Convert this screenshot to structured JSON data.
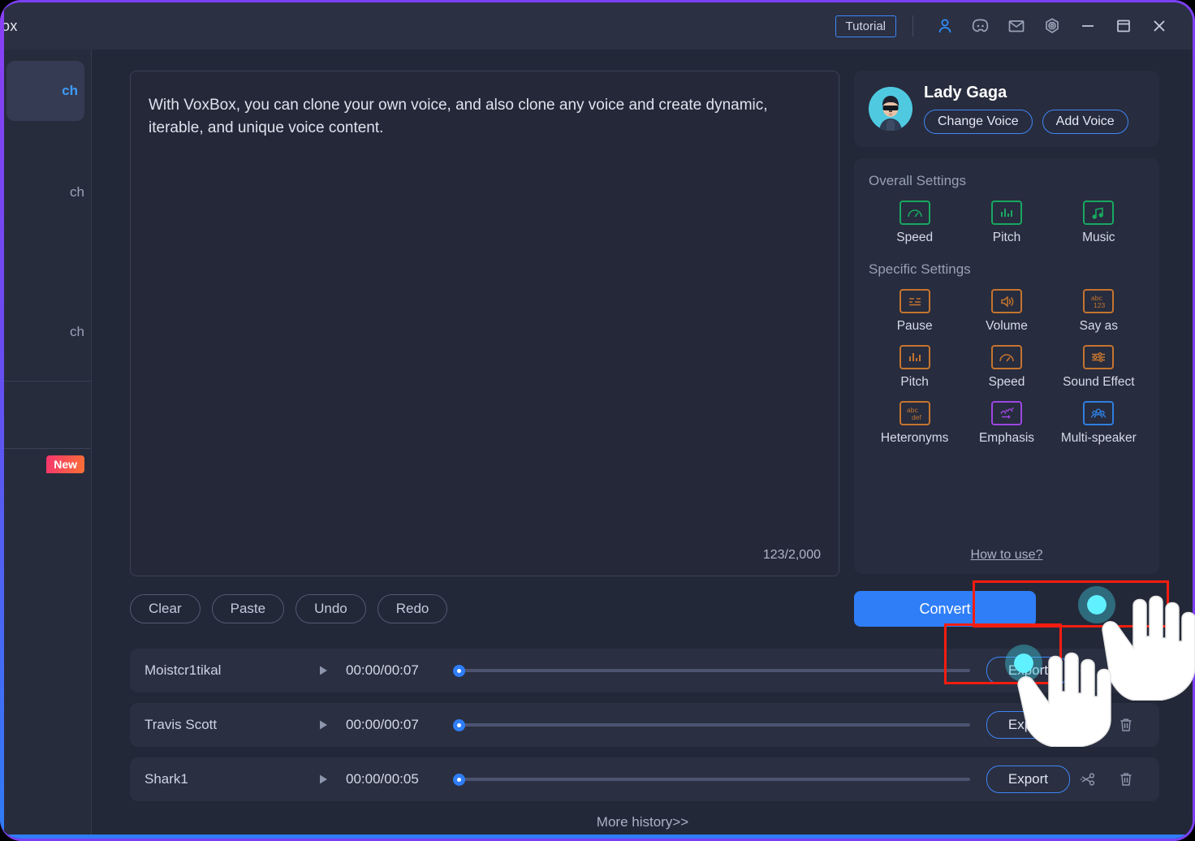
{
  "window": {
    "title": "ox",
    "accent_border": "#7b3ff2"
  },
  "titlebar": {
    "tutorial_label": "Tutorial",
    "icons": [
      {
        "name": "account-icon",
        "glyph": "person"
      },
      {
        "name": "discord-icon",
        "glyph": "gamepad"
      },
      {
        "name": "mail-icon",
        "glyph": "envelope"
      },
      {
        "name": "settings-icon",
        "glyph": "gear"
      },
      {
        "name": "minimize-icon",
        "glyph": "minus"
      },
      {
        "name": "maximize-icon",
        "glyph": "square"
      },
      {
        "name": "close-icon",
        "glyph": "cross"
      }
    ]
  },
  "sidebar": {
    "items": [
      {
        "label": "ch",
        "active": true
      },
      {
        "label": "ch",
        "active": false
      },
      {
        "label": "ch",
        "active": false
      }
    ],
    "new_badge": "New"
  },
  "editor": {
    "text": "With VoxBox, you can clone your own voice, and also clone any voice and create dynamic, iterable, and unique voice content.",
    "char_count": "123/2,000",
    "actions": [
      {
        "label": "Clear"
      },
      {
        "label": "Paste"
      },
      {
        "label": "Undo"
      },
      {
        "label": "Redo"
      }
    ]
  },
  "voice_card": {
    "name": "Lady Gaga",
    "change_voice_label": "Change Voice",
    "add_voice_label": "Add Voice"
  },
  "settings": {
    "overall_label": "Overall Settings",
    "overall_items": [
      {
        "label": "Speed",
        "icon": "gauge-icon",
        "color": "#18a861"
      },
      {
        "label": "Pitch",
        "icon": "bars-icon",
        "color": "#18a861"
      },
      {
        "label": "Music",
        "icon": "music-note-icon",
        "color": "#18a861"
      }
    ],
    "specific_label": "Specific Settings",
    "specific_items": [
      {
        "label": "Pause",
        "icon": "pause-lines-icon",
        "color": "#c4742f"
      },
      {
        "label": "Volume",
        "icon": "speaker-icon",
        "color": "#c4742f"
      },
      {
        "label": "Say as",
        "icon": "abc123-icon",
        "color": "#c4742f"
      },
      {
        "label": "Pitch",
        "icon": "bars-icon",
        "color": "#c4742f"
      },
      {
        "label": "Speed",
        "icon": "gauge-icon",
        "color": "#c4742f"
      },
      {
        "label": "Sound Effect",
        "icon": "sliders-icon",
        "color": "#c4742f"
      },
      {
        "label": "Heteronyms",
        "icon": "abcdef-icon",
        "color": "#c4742f"
      },
      {
        "label": "Emphasis",
        "icon": "arrows-icon",
        "color": "#9c46e0"
      },
      {
        "label": "Multi-speaker",
        "icon": "people-icon",
        "color": "#2f7fe0"
      }
    ],
    "how_to_use_label": "How to use?"
  },
  "convert": {
    "label": "Convert"
  },
  "tracks": [
    {
      "name": "Moistcr1tikal",
      "time": "00:00/00:07",
      "export_label": "Export",
      "progress": 0
    },
    {
      "name": "Travis Scott",
      "time": "00:00/00:07",
      "export_label": "Export",
      "progress": 0
    },
    {
      "name": "Shark1",
      "time": "00:00/00:05",
      "export_label": "Export",
      "progress": 0
    }
  ],
  "footer": {
    "more_history_label": "More history>>"
  }
}
